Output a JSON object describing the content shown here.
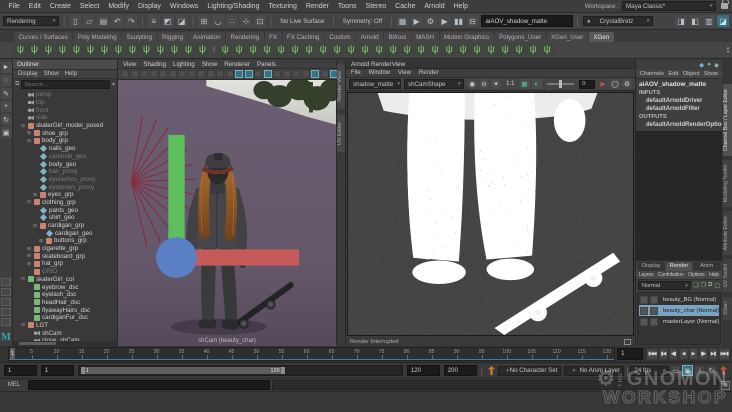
{
  "menubar": {
    "items": [
      "File",
      "Edit",
      "Create",
      "Select",
      "Modify",
      "Display",
      "Windows",
      "Lighting/Shading",
      "Texturing",
      "Render",
      "Toons",
      "Stereo",
      "Cache",
      "Arnold",
      "Help"
    ],
    "workspace_label": "Workspace :",
    "workspace_value": "Maya Classic*"
  },
  "statusline": {
    "menuset": "Rendering",
    "icon_groups": [
      [
        "new-scene-icon",
        "open-scene-icon",
        "save-scene-icon",
        "undo-icon",
        "redo-icon"
      ],
      [
        "select-hierarchy-icon",
        "select-object-icon",
        "select-component-icon"
      ],
      [
        "snap-grid-icon",
        "snap-curve-icon",
        "snap-point-icon",
        "snap-projected-icon",
        "snap-view-icon"
      ]
    ],
    "live_surface": "No Live Surface",
    "symmetry": "Symmetry: Off",
    "mid_icons": [
      "render-frame-icon",
      "ipr-render-icon",
      "render-settings-icon"
    ],
    "pause_icons": [
      "play-icon",
      "pause-icon",
      "layout-icon"
    ],
    "selection_value": "aiAOV_shadow_matte",
    "character_set": "CrystalBretz",
    "right_icons": [
      "sidebar-attr-editor-icon",
      "sidebar-tool-settings-icon",
      "sidebar-channel-box-icon",
      "sidebar-modeling-toolkit-icon"
    ]
  },
  "shelf": {
    "tabs": [
      "Curves / Surfaces",
      "Poly Modeling",
      "Sculpting",
      "Rigging",
      "Animation",
      "Rendering",
      "FX",
      "FX Caching",
      "Custom",
      "Arnold",
      "Bifrost",
      "MASH",
      "Motion Graphics",
      "Polygons_User",
      "XGen_User",
      "XGen"
    ],
    "active_tab": "XGen",
    "group1_count": 14,
    "group2_count": 24
  },
  "toolbox": {
    "tools": [
      "select-tool-icon",
      "lasso-tool-icon",
      "paint-select-tool-icon",
      "move-tool-icon",
      "rotate-tool-icon",
      "scale-tool-icon"
    ],
    "layouts": [
      "layout-single-pane-icon",
      "layout-four-pane-icon",
      "layout-split-lr-icon",
      "layout-split-tb-icon",
      "layout-outliner-persp-icon"
    ],
    "logo": "M"
  },
  "outliner": {
    "title": "Outliner",
    "menus": [
      "Display",
      "Show",
      "Help"
    ],
    "search_placeholder": "Search...",
    "items": [
      {
        "label": "persp",
        "icon": "camera",
        "dim": true,
        "depth": 1
      },
      {
        "label": "top",
        "icon": "camera",
        "dim": true,
        "depth": 1
      },
      {
        "label": "front",
        "icon": "camera",
        "dim": true,
        "depth": 1
      },
      {
        "label": "side",
        "icon": "camera",
        "dim": true,
        "depth": 1
      },
      {
        "label": "skaterGirl_model_posed",
        "icon": "transform",
        "depth": 1,
        "exp": "open"
      },
      {
        "label": "shoe_grp",
        "icon": "transform",
        "depth": 2,
        "exp": "closed"
      },
      {
        "label": "body_grp",
        "icon": "transform",
        "depth": 2,
        "exp": "open"
      },
      {
        "label": "nails_geo",
        "icon": "mesh",
        "depth": 3
      },
      {
        "label": "caruncle_geo",
        "icon": "mesh",
        "depth": 3,
        "dim": true
      },
      {
        "label": "body_geo",
        "icon": "mesh",
        "depth": 3
      },
      {
        "label": "hair_proxy",
        "icon": "mesh",
        "depth": 3,
        "dim": true
      },
      {
        "label": "eyelashes_proxy",
        "icon": "mesh",
        "depth": 3,
        "dim": true
      },
      {
        "label": "eyebrows_proxy",
        "icon": "mesh",
        "depth": 3,
        "dim": true
      },
      {
        "label": "eyes_grp",
        "icon": "transform",
        "depth": 3,
        "exp": "closed"
      },
      {
        "label": "clothing_grp",
        "icon": "transform",
        "depth": 2,
        "exp": "open"
      },
      {
        "label": "pants_geo",
        "icon": "mesh",
        "depth": 3
      },
      {
        "label": "shirt_geo",
        "icon": "mesh",
        "depth": 3
      },
      {
        "label": "cardigan_grp",
        "icon": "transform",
        "depth": 3,
        "exp": "open"
      },
      {
        "label": "cardigan_geo",
        "icon": "mesh",
        "depth": 4
      },
      {
        "label": "buttons_grp",
        "icon": "transform",
        "depth": 4,
        "exp": "closed"
      },
      {
        "label": "cigarette_grp",
        "icon": "transform",
        "depth": 2,
        "exp": "closed"
      },
      {
        "label": "skateboard_grp",
        "icon": "transform",
        "depth": 2,
        "exp": "closed"
      },
      {
        "label": "hat_grp",
        "icon": "transform",
        "depth": 2,
        "exp": "closed"
      },
      {
        "label": "GRID",
        "icon": "transform",
        "depth": 2,
        "dim": true
      },
      {
        "label": "skaterGirl_col",
        "icon": "xgen",
        "depth": 1,
        "exp": "open"
      },
      {
        "label": "eyebrow_dsc",
        "icon": "xgen",
        "depth": 2
      },
      {
        "label": "eyelash_dsc",
        "icon": "xgen",
        "depth": 2
      },
      {
        "label": "headHair_dsc",
        "icon": "xgen",
        "depth": 2
      },
      {
        "label": "flyawayHairs_dsc",
        "icon": "xgen",
        "depth": 2
      },
      {
        "label": "cardiganFur_dsc",
        "icon": "xgen",
        "depth": 2
      },
      {
        "label": "LGT",
        "icon": "transform",
        "depth": 1,
        "exp": "open"
      },
      {
        "label": "shCam",
        "icon": "camera",
        "depth": 2
      },
      {
        "label": "close_shCam",
        "icon": "camera",
        "depth": 2
      }
    ]
  },
  "viewport": {
    "menus": [
      "View",
      "Shading",
      "Lighting",
      "Show",
      "Renderer",
      "Panels"
    ],
    "icons": [
      "select-camera-icon",
      "lock-camera-icon",
      "camera-attributes-icon",
      "bookmarks-icon",
      "image-plane-icon",
      "2d-pan-zoom-icon",
      "grease-pencil-icon",
      "grid-icon",
      "film-gate-icon",
      "resolution-gate-icon",
      "gate-mask-icon",
      "field-chart-icon",
      "safe-action-icon",
      "safe-title-icon",
      "fill-icon",
      "lights-icon",
      "shadows-icon",
      "ao-icon",
      "motion-blur-icon",
      "multisample-icon",
      "depth-of-field-icon",
      "isolate-select-icon",
      "xray-icon",
      "exposure-icon"
    ],
    "icons_on": [
      12,
      13,
      15,
      20,
      22
    ],
    "camera_label": "shCam (beauty_char)",
    "side_tabs": [
      "Render View",
      "UV Editor"
    ]
  },
  "renderview": {
    "title": "Arnold RenderView",
    "menus": [
      "File",
      "Window",
      "View",
      "Render"
    ],
    "aov": "shadow_matte",
    "camera": "shCamShape",
    "left_icons": [
      "start-ipr-icon",
      "pause-ipr-icon",
      "snapshot-icon"
    ],
    "zoom_ratio": "1:1",
    "mid_icons": [
      "aov-display-icon",
      "exposure-icon"
    ],
    "slider_value": "0",
    "right_icons": [
      "debug-icon",
      "help-icon",
      "settings-icon"
    ],
    "status": "Render Interrupted"
  },
  "channelbox": {
    "top_icons": [
      "character-set-icon",
      "object-details-icon",
      "pin-icon"
    ],
    "menus": [
      "Channels",
      "Edit",
      "Object",
      "Show"
    ],
    "node": "aiAOV_shadow_matte",
    "inputs_label": "INPUTS",
    "inputs": [
      "defaultArnoldDriver",
      "defaultArnoldFilter"
    ],
    "outputs_label": "OUTPUTS",
    "outputs": [
      "defaultArnoldRenderOptions"
    ]
  },
  "layer_editor": {
    "tabs": [
      "Display",
      "Render",
      "Anim"
    ],
    "active_tab": "Render",
    "menus": [
      "Layers",
      "Contribution",
      "Options",
      "Help"
    ],
    "blend": "Normal",
    "blend_icons": [
      "new-layer-icon",
      "new-layer-selected-icon",
      "copy-layer-icon",
      "empty-layer-icon"
    ],
    "layers": [
      {
        "name": "beauty_BG (Normal)",
        "selected": false
      },
      {
        "name": "beauty_char (Normal)",
        "selected": true
      },
      {
        "name": "masterLayer (Normal)",
        "selected": false
      }
    ]
  },
  "right_tabs": [
    "Channel Box / Layer Editor",
    "Modeling Toolkit",
    "Attribute Editor",
    "UV Toolkit",
    "XGen"
  ],
  "timeline": {
    "current": "1",
    "end": 120,
    "labels": [
      1,
      5,
      10,
      15,
      20,
      25,
      30,
      35,
      40,
      45,
      50,
      55,
      60,
      65,
      70,
      75,
      80,
      85,
      90,
      95,
      100,
      105,
      110,
      115,
      120
    ]
  },
  "playback": [
    "go-to-start-icon",
    "step-back-frame-icon",
    "step-back-key-icon",
    "play-backwards-icon",
    "play-forwards-icon",
    "step-forward-key-icon",
    "step-forward-frame-icon",
    "go-to-end-icon"
  ],
  "range": {
    "anim_start": "1",
    "playback_start": "1",
    "bar_start": "1",
    "bar_end": "120",
    "playback_end": "120",
    "anim_end": "200",
    "character_set": "No Character Set",
    "anim_layer": "No Anim Layer",
    "fps": "24 fps",
    "right_icons": [
      "speech-bubble-icon",
      "anim-pref-icon",
      "mute-icon",
      "loop-icon"
    ]
  },
  "command_line": {
    "label": "MEL"
  },
  "watermark": {
    "prefix": "THE",
    "title": "GNOMON",
    "subtitle": "WORKSHOP"
  }
}
